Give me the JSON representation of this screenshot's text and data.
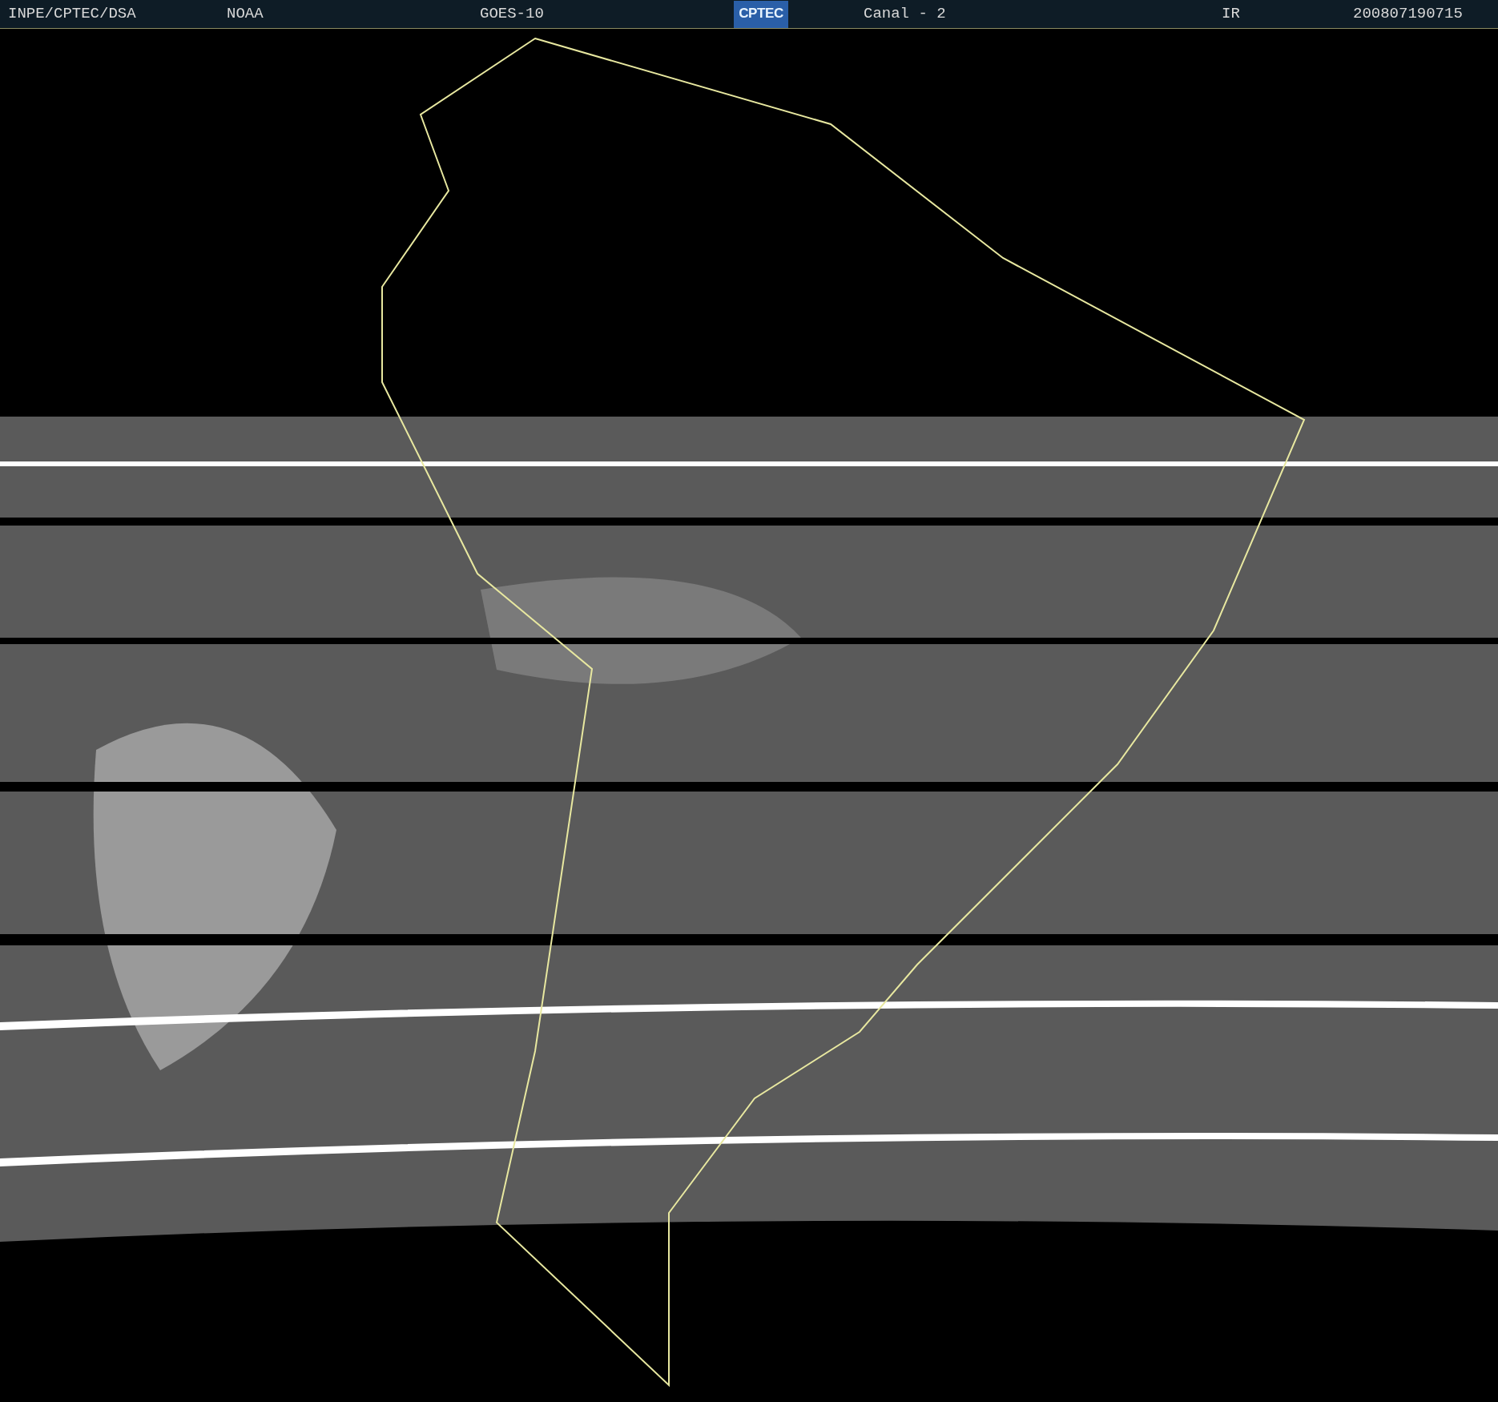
{
  "header": {
    "items": [
      {
        "kind": "text",
        "text": "INPE/CPTEC/DSA"
      },
      {
        "kind": "text",
        "text": "NOAA"
      },
      {
        "kind": "text",
        "text": "GOES-10"
      },
      {
        "kind": "logo",
        "text": "CPTEC"
      },
      {
        "kind": "text",
        "text": "Canal - 2"
      },
      {
        "kind": "text",
        "text": "IR"
      },
      {
        "kind": "text",
        "text": "200807190715"
      }
    ]
  }
}
